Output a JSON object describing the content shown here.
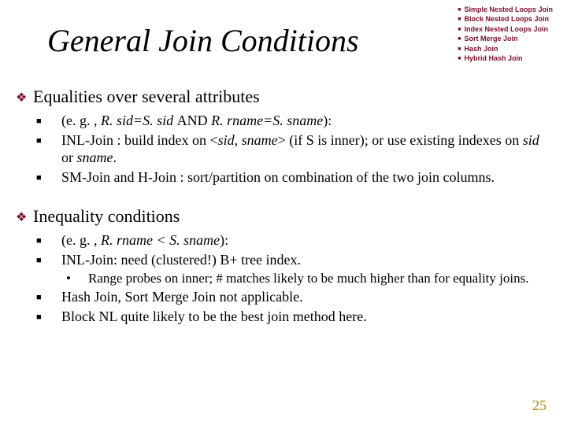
{
  "title": "General Join Conditions",
  "corner": [
    "Simple Nested Loops Join",
    "Block Nested Loops Join",
    "Index Nested Loops Join",
    "Sort Merge Join",
    "Hash Join",
    "Hybrid Hash Join"
  ],
  "sec1": {
    "heading": "Equalities over several attributes",
    "b1a": "(e. g. , ",
    "b1b": "R. sid=S. sid ",
    "b1c": "AND",
    "b1d": " R. rname=S. sname",
    "b1e": "):",
    "b2a": "INL-Join : build index on <",
    "b2b": "sid, sname",
    "b2c": "> (if S is inner); or use existing indexes on ",
    "b2d": "sid",
    "b2e": " or ",
    "b2f": "sname",
    "b2g": ".",
    "b3": "SM-Join and H-Join :  sort/partition on combination of the two join columns."
  },
  "sec2": {
    "heading": "Inequality conditions",
    "b1a": "(e. g. , ",
    "b1b": "R. rname < S. sname",
    "b1c": "):",
    "b2": "INL-Join:  need (clustered!) B+ tree index.",
    "b2sub": "Range probes on inner; # matches likely to be much higher than for equality joins.",
    "b3": "Hash Join, Sort Merge Join not applicable.",
    "b4": "Block NL quite likely to be the best join method here."
  },
  "pagenum": "25"
}
